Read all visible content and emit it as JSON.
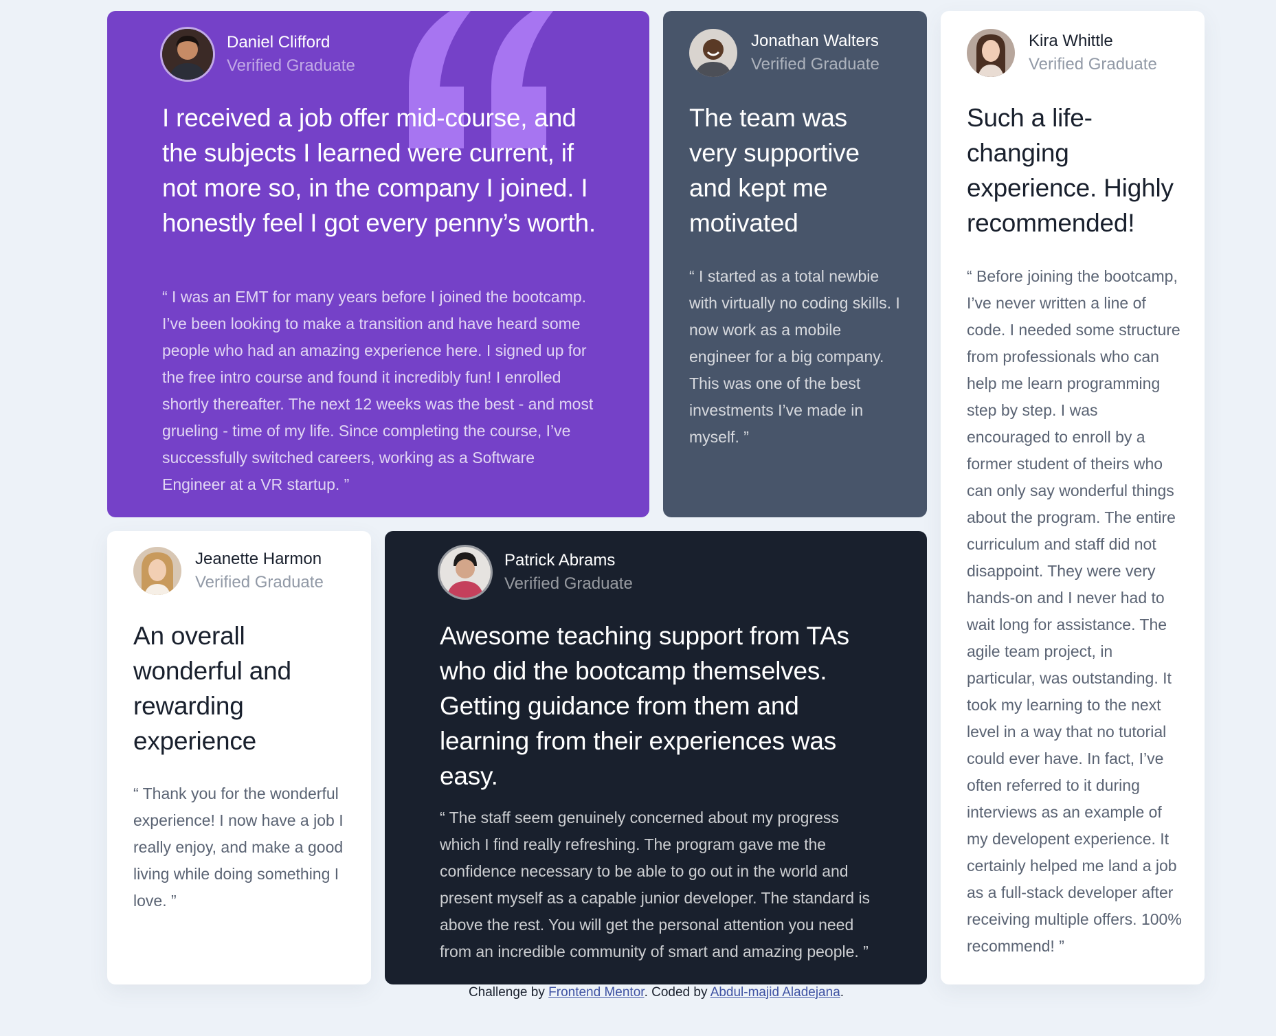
{
  "testimonials": [
    {
      "name": "Daniel Clifford",
      "role": "Verified Graduate",
      "headline": "I received a job offer mid-course, and the subjects I learned were current, if not more so, in the company I joined. I honestly feel I got every penny’s worth.",
      "body": "“ I was an EMT for many years before I joined the bootcamp. I’ve been looking to make a transition and have heard some people who had an amazing experience here. I signed up for the free intro course and found it incredibly fun! I enrolled shortly thereafter. The next 12 weeks was the best - and most grueling - time of my life. Since completing the course, I’ve successfully switched careers, working as a Software Engineer at a VR startup. ”"
    },
    {
      "name": "Jonathan Walters",
      "role": "Verified Graduate",
      "headline": "The team was very supportive and kept me motivated",
      "body": "“ I started as a total newbie with virtually no coding skills. I now work as a mobile engineer for a big company. This was one of the best investments I’ve made in myself. ”"
    },
    {
      "name": "Kira Whittle",
      "role": "Verified Graduate",
      "headline": "Such a life-changing experience. Highly recommended!",
      "body": "“ Before joining the bootcamp, I’ve never written a line of code. I needed some structure from professionals who can help me learn programming step by step. I was encouraged to enroll by a former student of theirs who can only say wonderful things about the program. The entire curriculum and staff did not disappoint. They were very hands-on and I never had to wait long for assistance. The agile team project, in particular, was outstanding. It took my learning to the next level in a way that no tutorial could ever have. In fact, I’ve often referred to it during interviews as an example of my developent experience. It certainly helped me land a job as a full-stack developer after receiving multiple offers. 100% recommend! ”"
    },
    {
      "name": "Jeanette Harmon",
      "role": "Verified Graduate",
      "headline": "An overall wonderful and rewarding experience",
      "body": "“ Thank you for the wonderful experience! I now have a job I really enjoy, and make a good living while doing something I love. ”"
    },
    {
      "name": "Patrick Abrams",
      "role": "Verified Graduate",
      "headline": "Awesome teaching support from TAs who did the bootcamp themselves. Getting guidance from them and learning from their experiences was easy.",
      "body": "“ The staff seem genuinely concerned about my progress which I find really refreshing. The program gave me the confidence necessary to be able to go out in the world and present myself as a capable junior developer. The standard is above the rest. You will get the personal attention you need from an incredible community of smart and amazing people. ”"
    }
  ],
  "footer": {
    "prefix": "Challenge by ",
    "link1": "Frontend Mentor",
    "middle": ". Coded by ",
    "link2": "Abdul-majid Aladejana",
    "suffix": "."
  },
  "colors": {
    "purple": "#7541c8",
    "slate": "#48556a",
    "dark": "#19202d",
    "white": "#ffffff",
    "background": "#edf2f8"
  }
}
